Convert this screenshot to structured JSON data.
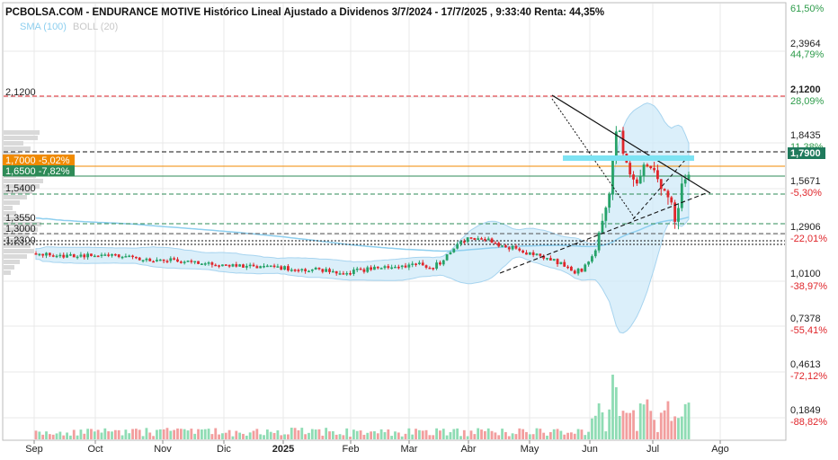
{
  "colors": {
    "up": "#26a269",
    "down": "#e0262b",
    "price_badge": "#1f7a5c",
    "level_orange": "#f08a00",
    "level_green": "#2e8b57",
    "sma": "#8ecfef",
    "boll_fill": "#cfe9f8",
    "boll_line": "#a7d4ef",
    "highlight": "#7de3f3",
    "grid": "#e8e8e8",
    "pct_up": "#2e9c4b",
    "pct_down": "#e0262b",
    "axis_text": "#222222"
  },
  "chart_data": {
    "type": "candlestick",
    "title": "PCBOLSA.COM - ENDURANCE MOTIVE Histórico Lineal Ajustado a Dividenos 3/7/2024 - 17/7/2025 , 9:33:40 Renta: 44,35%",
    "legend": [
      "SMA (100)",
      "BOLL (20)"
    ],
    "x_ticks": [
      "Sep",
      "Oct",
      "Nov",
      "Dic",
      "2025",
      "Feb",
      "Mar",
      "Abr",
      "May",
      "Jun",
      "Jul",
      "Ago"
    ],
    "y_axis": {
      "prices": [
        "2,3964",
        "2,1200",
        "1,8435",
        "1,5671",
        "1,2906",
        "1,0100",
        "0,7378",
        "0,4613",
        "0,1849"
      ],
      "percents": [
        "61,50%",
        "44,79%",
        "28,09%",
        "11,38%",
        "-5,30%",
        "-22,01%",
        "-38,97%",
        "-55,41%",
        "-72,12%",
        "-88,82%"
      ],
      "current_price": "1,7900"
    },
    "levels": [
      {
        "label": "2,1200",
        "color": "#e0262b",
        "style": "dashed",
        "side": "left"
      },
      {
        "label": "1,7000 -5,02%",
        "color": "#f08a00",
        "style": "solid",
        "side": "left-badge"
      },
      {
        "label": "1,6500 -7,82%",
        "color": "#2e8b57",
        "style": "solid",
        "side": "left-badge"
      },
      {
        "label": "1,5400",
        "color": "#2e8b57",
        "style": "dashed",
        "side": "left"
      },
      {
        "label": "1,3550",
        "color": "#2e8b57",
        "style": "dashed",
        "side": "left"
      },
      {
        "label": "1,3000",
        "color": "#555555",
        "style": "dashed",
        "side": "left"
      },
      {
        "label": "1,2300",
        "color": "#111111",
        "style": "dotted",
        "side": "left"
      }
    ]
  }
}
